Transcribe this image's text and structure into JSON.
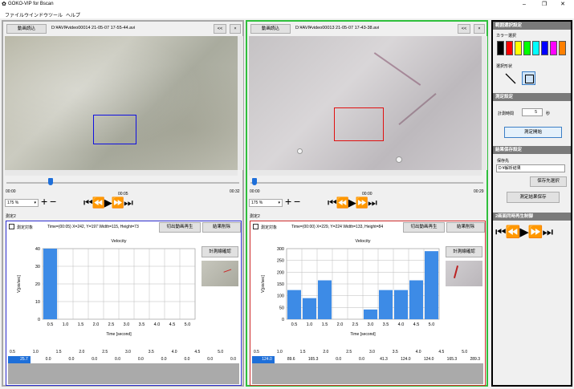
{
  "app_title": "GOKO-VIP for Bscan",
  "menu": [
    "ファイル",
    "ウインドウ",
    "ツール",
    "ヘルプ"
  ],
  "left": {
    "load_btn": "動画読込",
    "path": "D:¥AVI¥video00014 21-05-07 17-55-44.avi",
    "t_start": "00:00",
    "t_mid": "00:05",
    "t_end": "00:32",
    "zoom": "175 %",
    "meas_label": "測定2",
    "checkbox_label": "測定対象",
    "info": "Time=(00:05) X=242, Y=197 Width=115, Height=73",
    "play_btn": "切出動画再生",
    "del_btn": "結果削除",
    "confirm_btn": "計測線確認",
    "chart_title": "Velocity",
    "ylabel": "V[pix/sec]",
    "xlabel": "Time [second]",
    "table_headers": [
      "0.5",
      "1.0",
      "1.5",
      "2.0",
      "2.5",
      "3.0",
      "3.5",
      "4.0",
      "4.5",
      "5.0"
    ],
    "table_values": [
      "25.7",
      "0.0",
      "0.0",
      "0.0",
      "0.0",
      "0.0",
      "0.0",
      "0.0",
      "0.0",
      "0.0"
    ]
  },
  "right": {
    "load_btn": "動画読込",
    "path": "D:¥AVI¥video00013 21-05-07 17-43-38.avi",
    "t_start": "00:00",
    "t_mid": "00:00",
    "t_end": "00:29",
    "zoom": "175 %",
    "meas_label": "測定2",
    "checkbox_label": "測定対象",
    "info": "Time=(00:00) X=229, Y=224 Width=133, Height=84",
    "play_btn": "切出動画再生",
    "del_btn": "結果削除",
    "confirm_btn": "計測線確認",
    "chart_title": "Velocity",
    "ylabel": "V[pix/sec]",
    "xlabel": "Time [second]",
    "table_headers": [
      "0.5",
      "1.0",
      "1.5",
      "2.0",
      "2.5",
      "3.0",
      "3.5",
      "4.0",
      "4.5",
      "5.0"
    ],
    "table_values": [
      "124.0",
      "89.6",
      "165.3",
      "0.0",
      "0.0",
      "41.3",
      "124.0",
      "124.0",
      "165.3",
      "289.3"
    ]
  },
  "side": {
    "range_head": "範囲選択設定",
    "color_label": "カラー選択",
    "shape_label": "選択形状",
    "meas_head": "測定設定",
    "time_label": "計測時間",
    "time_value": "5",
    "time_unit": "秒",
    "start_btn": "測定開始",
    "save_head": "結果保存設定",
    "save_label": "保存先",
    "save_path": "D:¥解析結果",
    "save_sel_btn": "保存先選択",
    "save_btn": "測定結果保存",
    "sync_head": "2画面同時再生制御",
    "colors": [
      "#000000",
      "#ff0000",
      "#ffff00",
      "#00ff00",
      "#00ffff",
      "#0000ff",
      "#ff00ff",
      "#ff8000"
    ]
  },
  "chart_data": [
    {
      "type": "bar",
      "title": "Velocity",
      "xlabel": "Time [second]",
      "ylabel": "V[pix/sec]",
      "categories": [
        "0.5",
        "1.0",
        "1.5",
        "2.0",
        "2.5",
        "3.0",
        "3.5",
        "4.0",
        "4.5",
        "5.0"
      ],
      "values": [
        40,
        0,
        0,
        0,
        0,
        0,
        0,
        0,
        0,
        0
      ],
      "ylim": [
        0,
        40
      ],
      "yticks": [
        "0",
        "10",
        "20",
        "30",
        "40"
      ],
      "grid": true
    },
    {
      "type": "bar",
      "title": "Velocity",
      "xlabel": "Time [second]",
      "ylabel": "V[pix/sec]",
      "categories": [
        "0.5",
        "1.0",
        "1.5",
        "2.0",
        "2.5",
        "3.0",
        "3.5",
        "4.0",
        "4.5",
        "5.0"
      ],
      "values": [
        124.0,
        89.6,
        165.3,
        0.0,
        0.0,
        41.3,
        124.0,
        124.0,
        165.3,
        289.3
      ],
      "ylim": [
        0,
        300
      ],
      "yticks": [
        "0",
        "50",
        "100",
        "150",
        "200",
        "250",
        "300"
      ],
      "grid": true
    }
  ]
}
